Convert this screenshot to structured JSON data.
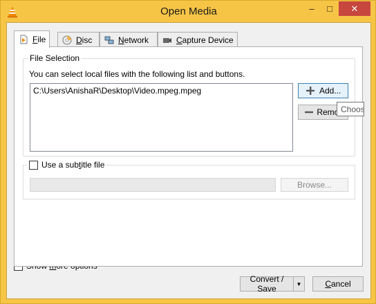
{
  "window": {
    "title": "Open Media",
    "minimize_glyph": "–",
    "maximize_glyph": "□",
    "close_glyph": "✕"
  },
  "tabs": [
    {
      "label_pre": "",
      "label_u": "F",
      "label_post": "ile",
      "icon": "file-play-icon"
    },
    {
      "label_pre": "",
      "label_u": "D",
      "label_post": "isc",
      "icon": "disc-icon"
    },
    {
      "label_pre": "",
      "label_u": "N",
      "label_post": "etwork",
      "icon": "network-icon"
    },
    {
      "label_pre": "",
      "label_u": "C",
      "label_post": "apture Device",
      "icon": "capture-icon"
    }
  ],
  "file_selection": {
    "title": "File Selection",
    "hint": "You can select local files with the following list and buttons.",
    "files": [
      "C:\\Users\\AnishaR\\Desktop\\Video.mpeg.mpeg"
    ],
    "add_label": "Add...",
    "remove_label": "Remove",
    "tooltip": "Choose one or more media file to open"
  },
  "subtitle": {
    "label_pre": "Use a sub",
    "label_u": "t",
    "label_post": "itle file",
    "checked": false,
    "path_value": "",
    "browse_label": "Browse..."
  },
  "footer": {
    "more_label_pre": "Show ",
    "more_label_u": "m",
    "more_label_post": "ore options",
    "convert_label": "Convert / Save",
    "convert_arrow": "▼",
    "cancel_label_u": "C",
    "cancel_label_post": "ancel"
  },
  "colors": {
    "title_bar": "#f7c546",
    "close_button": "#c7463e",
    "accent": "#3c7fb1"
  }
}
